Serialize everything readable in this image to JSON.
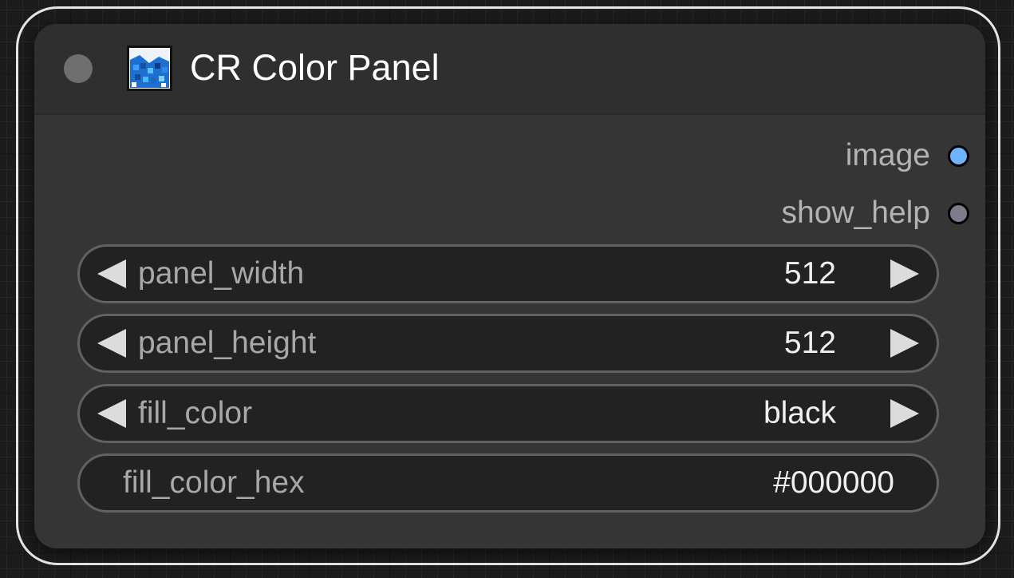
{
  "node": {
    "title": "CR Color Panel",
    "icon": "color-panel-node-icon",
    "outputs": [
      {
        "label": "image",
        "color": "#6eb3ff"
      },
      {
        "label": "show_help",
        "color": "#7c7c8c"
      }
    ],
    "widgets": [
      {
        "label": "panel_width",
        "value": "512",
        "kind": "number"
      },
      {
        "label": "panel_height",
        "value": "512",
        "kind": "number"
      },
      {
        "label": "fill_color",
        "value": "black",
        "kind": "combo"
      },
      {
        "label": "fill_color_hex",
        "value": "#000000",
        "kind": "text"
      }
    ]
  },
  "colors": {
    "canvas_background": "#1b1b1b",
    "node_body": "#353535",
    "node_header": "#2f2f2f",
    "selection_outline": "#e6e6e6",
    "widget_background": "#222222",
    "widget_border": "#616161"
  }
}
